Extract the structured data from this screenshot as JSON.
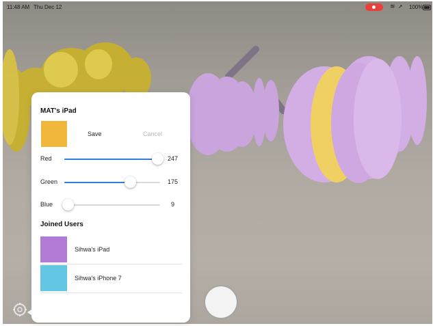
{
  "status_bar": {
    "time": "11:48 AM",
    "date": "Thu Dec 12",
    "battery": "100%"
  },
  "panel": {
    "title": "MAT's iPad",
    "current_color": "#f1b73c",
    "save_label": "Save",
    "cancel_label": "Cancel",
    "sliders": [
      {
        "label": "Red",
        "value": "247",
        "fraction": 0.969
      },
      {
        "label": "Green",
        "value": "175",
        "fraction": 0.686
      },
      {
        "label": "Blue",
        "value": "9",
        "fraction": 0.035
      }
    ],
    "joined_users_title": "Joined Users",
    "joined_users": [
      {
        "name": "Sihwa's iPad",
        "color": "#b27bd6"
      },
      {
        "name": "Sihwa's iPhone 7",
        "color": "#62c6e4"
      }
    ]
  },
  "colors": {
    "accent": "#2f7de0",
    "ar_yellow": "#cbb43a",
    "ar_purple": "#cfa8e0"
  },
  "icons": [
    "gear-icon",
    "wifi-icon",
    "location-icon",
    "battery-icon",
    "record-icon",
    "shutter-button"
  ]
}
